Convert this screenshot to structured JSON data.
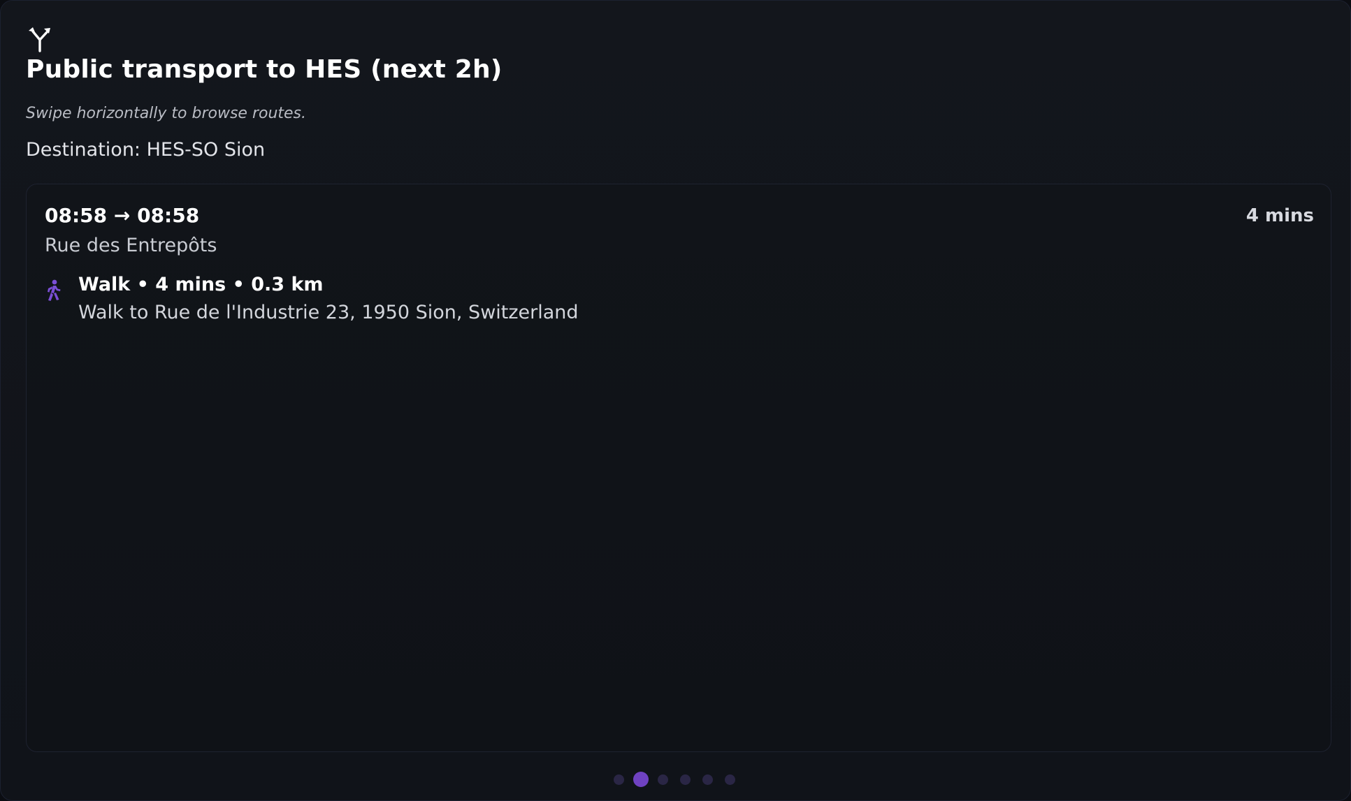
{
  "header": {
    "icon": "fork-route-icon",
    "title": "Public transport to HES (next 2h)",
    "subtitle": "Swipe horizontally to browse routes.",
    "destination": "Destination: HES-SO Sion"
  },
  "route": {
    "times": "08:58 → 08:58",
    "duration": "4 mins",
    "origin": "Rue des Entrepôts",
    "legs": [
      {
        "icon": "walk-icon",
        "summary": "Walk • 4 mins • 0.3 km",
        "detail": "Walk to Rue de l'Industrie 23, 1950 Sion, Switzerland"
      }
    ]
  },
  "pagination": {
    "total": 6,
    "active_index": 1
  },
  "colors": {
    "accent": "#6f42c1",
    "walk_icon": "#7b4fd6",
    "background": "#13161c",
    "inactive_dot": "#2a2645"
  }
}
